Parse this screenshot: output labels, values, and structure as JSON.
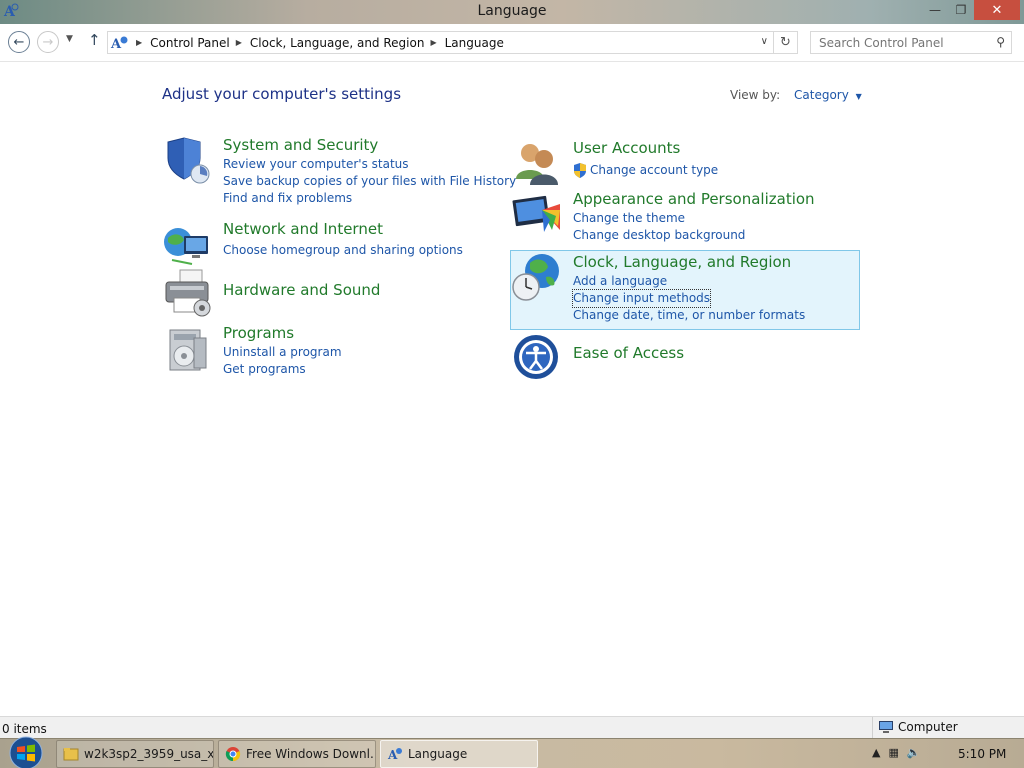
{
  "window": {
    "title": "Language",
    "buttons": {
      "minimize": "—",
      "restore": "❐",
      "close": "✕"
    }
  },
  "addressbar": {
    "breadcrumb": [
      "Control Panel",
      "Clock, Language, and Region",
      "Language"
    ],
    "search_placeholder": "Search Control Panel"
  },
  "main": {
    "heading": "Adjust your computer's settings",
    "view_by_label": "View by:",
    "view_by_value": "Category",
    "categories_left": [
      {
        "title": "System and Security",
        "icon": "shield-icon",
        "links": [
          "Review your computer's status",
          "Save backup copies of your files with File History",
          "Find and fix problems"
        ]
      },
      {
        "title": "Network and Internet",
        "icon": "network-icon",
        "links": [
          "Choose homegroup and sharing options"
        ]
      },
      {
        "title": "Hardware and Sound",
        "icon": "printer-icon",
        "links": []
      },
      {
        "title": "Programs",
        "icon": "programs-icon",
        "links": [
          "Uninstall a program",
          "Get programs"
        ]
      }
    ],
    "categories_right": [
      {
        "title": "User Accounts",
        "icon": "users-icon",
        "links": [
          "Change account type"
        ]
      },
      {
        "title": "Appearance and Personalization",
        "icon": "display-icon",
        "links": [
          "Change the theme",
          "Change desktop background"
        ]
      },
      {
        "title": "Clock, Language, and Region",
        "icon": "globe-clock-icon",
        "links": [
          "Add a language",
          "Change input methods",
          "Change date, time, or number formats"
        ]
      },
      {
        "title": "Ease of Access",
        "icon": "ease-of-access-icon",
        "links": []
      }
    ]
  },
  "statusbar": {
    "items": "0 items",
    "location": "Computer"
  },
  "taskbar": {
    "tasks": [
      "w2k3sp2_3959_usa_x...",
      "Free Windows Downl...",
      "Language"
    ],
    "clock": "5:10 PM"
  },
  "colors": {
    "link": "#1e56a8",
    "category_title": "#217a2b",
    "heading": "#1e3287",
    "highlight_bg": "#e3f4fc",
    "highlight_border": "#80c7e8"
  }
}
